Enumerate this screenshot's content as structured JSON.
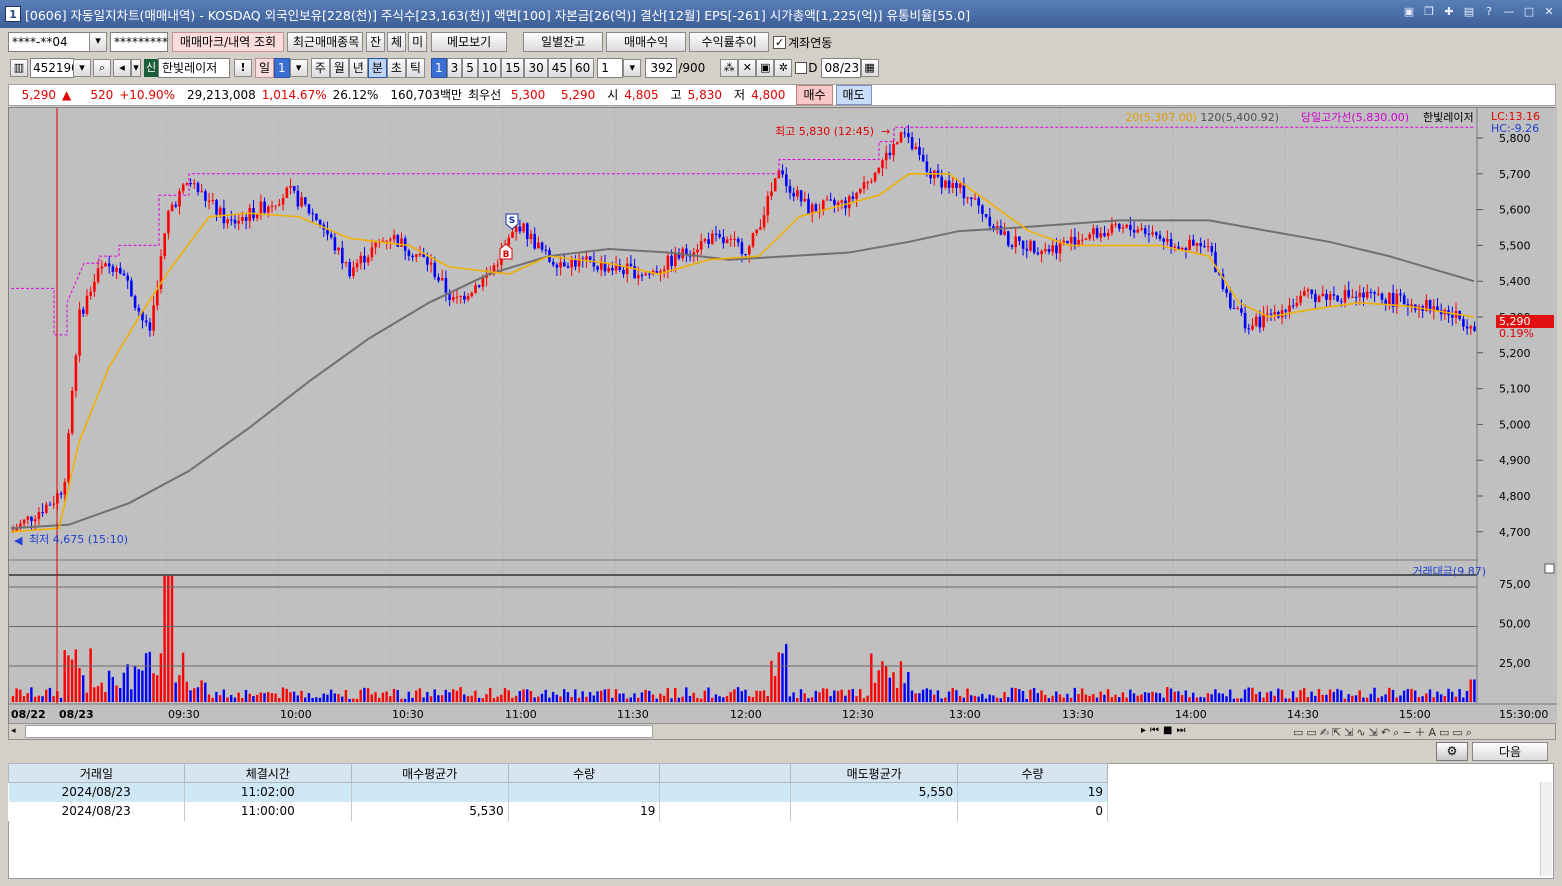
{
  "window": {
    "badge": "1",
    "title": "[0606] 자동일지차트(매매내역) - KOSDAQ 외국인보유[228(천)] 주식수[23,163(천)] 액면[100] 자본금[26(억)] 결산[12월] EPS[-261] 시가총액[1,225(억)] 유통비율[55.0]"
  },
  "toolbar1": {
    "account": "****-**04",
    "password": "*********",
    "buttons": [
      "매매마크/내역 조회",
      "최근매매종목",
      "잔",
      "체",
      "미",
      "메모보기",
      "일별잔고",
      "매매수익",
      "수익률추이"
    ],
    "account_link_label": "계좌연동"
  },
  "toolbar2": {
    "code": "452190",
    "stock_name": "한빛레이저",
    "periods": [
      "일",
      "1",
      "주",
      "월",
      "년",
      "분",
      "초",
      "틱"
    ],
    "intervals": [
      "1",
      "3",
      "5",
      "10",
      "15",
      "30",
      "45",
      "60"
    ],
    "interval_select": "1",
    "count": "392",
    "count_max": "/900",
    "d_label": "D",
    "date": "08/23"
  },
  "quote": {
    "price": "5,290",
    "change": "520",
    "change_pct": "+10.90%",
    "volume": "29,213,008",
    "vol_ratio": "1,014.67%",
    "turnover": "26.12%",
    "amount": "160,703백만",
    "best_label": "최우선",
    "best_ask": "5,300",
    "best_bid": "5,290",
    "open_label": "시",
    "open": "4,805",
    "high_label": "고",
    "high": "5,830",
    "low_label": "저",
    "low": "4,800",
    "buy": "매수",
    "sell": "매도"
  },
  "chart": {
    "legend_ma20": "20(5,307.00)",
    "legend_ma120": "120(5,400.92)",
    "legend_day_high": "당일고가선(5,830.00)",
    "legend_stock": "한빛레이저",
    "lc": "LC:13.16",
    "hc": "HC:-9.26",
    "high_note": "최고 5,830 (12:45)",
    "low_note": "최저 4,675 (15:10)",
    "y_ticks": [
      "5,800",
      "5,700",
      "5,600",
      "5,500",
      "5,400",
      "5,300",
      "5,200",
      "5,100",
      "5,000",
      "4,900",
      "4,800",
      "4,700"
    ],
    "current_price": "5,290",
    "current_pct": "0.19%",
    "vol_legend": "거래대금(9.87)",
    "vol_ticks": [
      "75,00",
      "50,00",
      "25,00"
    ],
    "x_labels": [
      "08/22",
      "08/23",
      "09:30",
      "10:00",
      "10:30",
      "11:00",
      "11:30",
      "12:00",
      "12:30",
      "13:00",
      "13:30",
      "14:00",
      "14:30",
      "15:00",
      "15:30:00"
    ],
    "mark_s": "S",
    "mark_b": "B"
  },
  "bottom": {
    "next_label": "다음",
    "headers": [
      "거래일",
      "체결시간",
      "매수평균가",
      "수량",
      "",
      "매도평균가",
      "수량"
    ],
    "rows": [
      [
        "2024/08/23",
        "11:02:00",
        "",
        "",
        "",
        "5,550",
        "19"
      ],
      [
        "2024/08/23",
        "11:00:00",
        "5,530",
        "19",
        "",
        "",
        "0"
      ]
    ]
  }
}
